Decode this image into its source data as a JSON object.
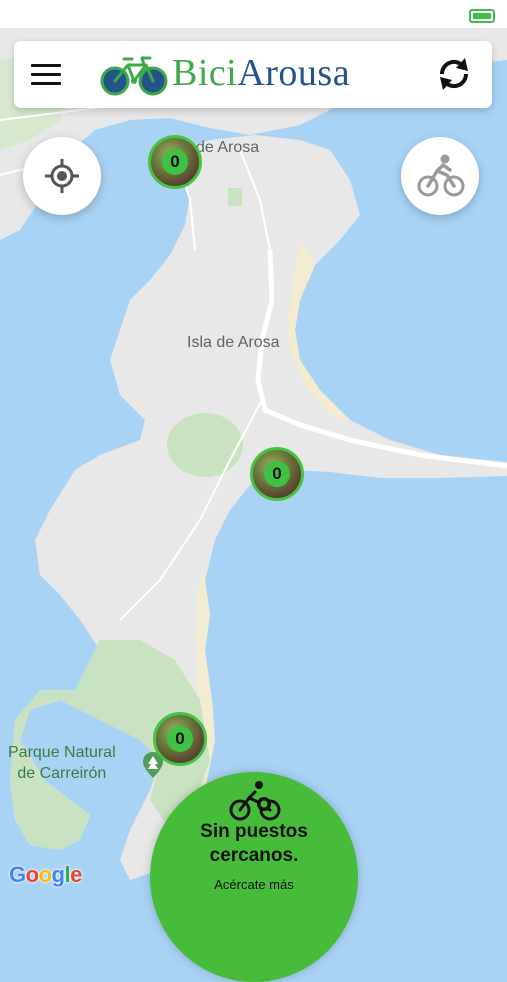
{
  "status_bar": {
    "battery_icon": "battery-icon"
  },
  "header": {
    "menu_icon": "hamburger-menu-icon",
    "logo_part1": "Bici",
    "logo_part2": "Arousa",
    "refresh_icon": "refresh-icon"
  },
  "map": {
    "town_label": "de Arosa",
    "island_label": "Isla de Arosa",
    "park_label_line1": "Parque Natural",
    "park_label_line2": "de Carreirón",
    "attribution": "Google",
    "markers": [
      {
        "count": "0"
      },
      {
        "count": "0"
      },
      {
        "count": "0"
      }
    ]
  },
  "controls": {
    "locate_icon": "my-location-icon",
    "bike_mode_icon": "bicycle-rider-icon"
  },
  "nearby": {
    "icon": "bike-search-icon",
    "title_line1": "Sin puestos",
    "title_line2": "cercanos.",
    "subtitle": "Acércate más"
  },
  "colors": {
    "brand_green": "#47bc3a",
    "brand_blue": "#22548a",
    "water": "#a9d3f5",
    "land": "#e8e8e8",
    "park": "#c9e3c2"
  }
}
